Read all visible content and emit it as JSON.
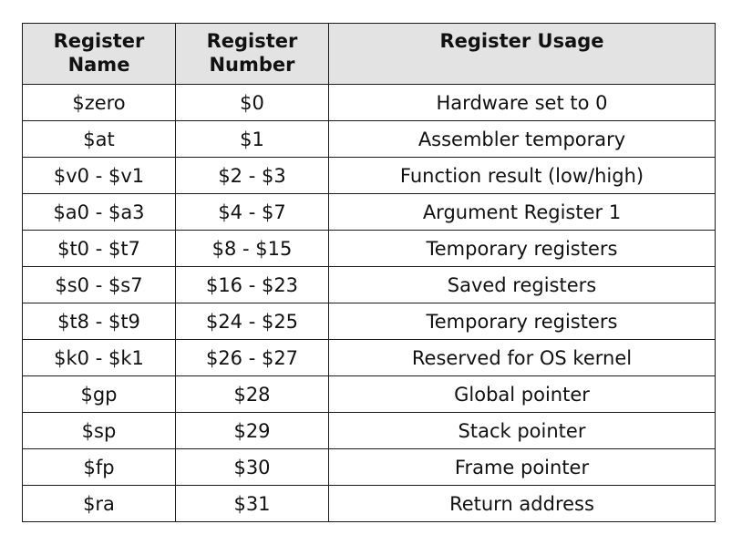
{
  "table": {
    "headers": {
      "name": "Register\nName",
      "number": "Register\nNumber",
      "usage": "Register Usage"
    },
    "rows": [
      {
        "name": "$zero",
        "number": "$0",
        "usage": "Hardware set to 0"
      },
      {
        "name": "$at",
        "number": "$1",
        "usage": "Assembler temporary"
      },
      {
        "name": "$v0 - $v1",
        "number": "$2 - $3",
        "usage": "Function result (low/high)"
      },
      {
        "name": "$a0 - $a3",
        "number": "$4 - $7",
        "usage": "Argument Register 1"
      },
      {
        "name": "$t0 - $t7",
        "number": "$8 - $15",
        "usage": "Temporary registers"
      },
      {
        "name": "$s0 - $s7",
        "number": "$16 - $23",
        "usage": "Saved registers"
      },
      {
        "name": "$t8 - $t9",
        "number": "$24 - $25",
        "usage": "Temporary registers"
      },
      {
        "name": "$k0 - $k1",
        "number": "$26 - $27",
        "usage": "Reserved for OS kernel"
      },
      {
        "name": "$gp",
        "number": "$28",
        "usage": "Global pointer"
      },
      {
        "name": "$sp",
        "number": "$29",
        "usage": "Stack pointer"
      },
      {
        "name": "$fp",
        "number": "$30",
        "usage": "Frame pointer"
      },
      {
        "name": "$ra",
        "number": "$31",
        "usage": "Return address"
      }
    ]
  }
}
